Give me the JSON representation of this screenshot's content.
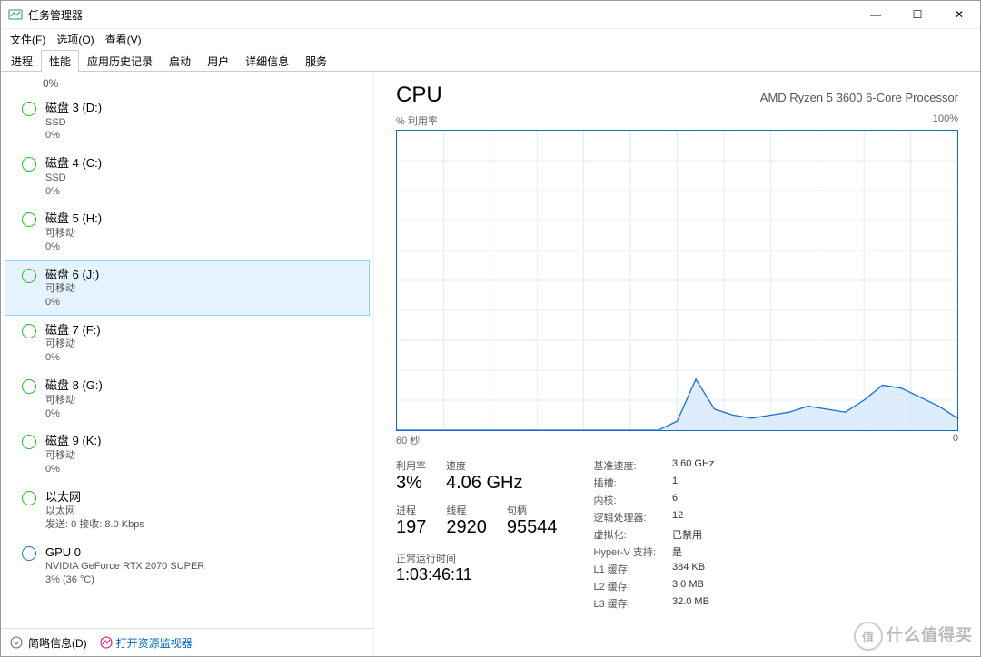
{
  "window": {
    "title": "任务管理器"
  },
  "winbuttons": {
    "min": "—",
    "max": "☐",
    "close": "✕"
  },
  "menubar": [
    "文件(F)",
    "选项(O)",
    "查看(V)"
  ],
  "tabs": {
    "items": [
      "进程",
      "性能",
      "应用历史记录",
      "启动",
      "用户",
      "详细信息",
      "服务"
    ],
    "activeIndex": 1
  },
  "sidebar": {
    "top_percent": "0%",
    "items": [
      {
        "icon": "green",
        "name": "磁盘 3 (D:)",
        "sub1": "SSD",
        "sub2": "0%"
      },
      {
        "icon": "green",
        "name": "磁盘 4 (C:)",
        "sub1": "SSD",
        "sub2": "0%"
      },
      {
        "icon": "green",
        "name": "磁盘 5 (H:)",
        "sub1": "可移动",
        "sub2": "0%"
      },
      {
        "icon": "green",
        "name": "磁盘 6 (J:)",
        "sub1": "可移动",
        "sub2": "0%",
        "selected": true
      },
      {
        "icon": "green",
        "name": "磁盘 7 (F:)",
        "sub1": "可移动",
        "sub2": "0%"
      },
      {
        "icon": "green",
        "name": "磁盘 8 (G:)",
        "sub1": "可移动",
        "sub2": "0%"
      },
      {
        "icon": "green",
        "name": "磁盘 9 (K:)",
        "sub1": "可移动",
        "sub2": "0%"
      },
      {
        "icon": "green",
        "name": "以太网",
        "sub1": "以太网",
        "sub2": "发送: 0 接收: 8.0 Kbps"
      },
      {
        "icon": "blue",
        "name": "GPU 0",
        "sub1": "NVIDIA GeForce RTX 2070 SUPER",
        "sub2": "3% (36 °C)"
      }
    ]
  },
  "footer": {
    "brief": "简略信息(D)",
    "open_resmon": "打开资源监视器"
  },
  "main": {
    "title": "CPU",
    "processor": "AMD Ryzen 5 3600 6-Core Processor",
    "chart_top_left": "% 利用率",
    "chart_top_right": "100%",
    "chart_bottom_left": "60 秒",
    "chart_bottom_right": "0",
    "stats1": [
      {
        "label": "利用率",
        "value": "3%"
      },
      {
        "label": "速度",
        "value": "4.06 GHz"
      }
    ],
    "stats2": [
      {
        "label": "进程",
        "value": "197"
      },
      {
        "label": "线程",
        "value": "2920"
      },
      {
        "label": "句柄",
        "value": "95544"
      }
    ],
    "uptime": {
      "label": "正常运行时间",
      "value": "1:03:46:11"
    },
    "props": [
      {
        "k": "基准速度:",
        "v": "3.60 GHz"
      },
      {
        "k": "插槽:",
        "v": "1"
      },
      {
        "k": "内核:",
        "v": "6"
      },
      {
        "k": "逻辑处理器:",
        "v": "12"
      },
      {
        "k": "虚拟化:",
        "v": "已禁用"
      },
      {
        "k": "Hyper-V 支持:",
        "v": "是"
      },
      {
        "k": "L1 缓存:",
        "v": "384 KB"
      },
      {
        "k": "L2 缓存:",
        "v": "3.0 MB"
      },
      {
        "k": "L3 缓存:",
        "v": "32.0 MB"
      }
    ]
  },
  "chart_data": {
    "type": "line",
    "title": "% 利用率",
    "xlabel": "60 秒 → 0",
    "ylabel": "% 利用率",
    "ylim": [
      0,
      100
    ],
    "x_seconds_ago": [
      60,
      58,
      56,
      54,
      52,
      50,
      48,
      46,
      44,
      42,
      40,
      38,
      36,
      34,
      32,
      30,
      28,
      26,
      24,
      22,
      20,
      18,
      16,
      14,
      12,
      10,
      8,
      6,
      4,
      2,
      0
    ],
    "values_percent": [
      0,
      0,
      0,
      0,
      0,
      0,
      0,
      0,
      0,
      0,
      0,
      0,
      0,
      0,
      0,
      3,
      17,
      7,
      5,
      4,
      5,
      6,
      8,
      7,
      6,
      10,
      15,
      14,
      11,
      8,
      4
    ]
  },
  "watermark": "什么值得买"
}
